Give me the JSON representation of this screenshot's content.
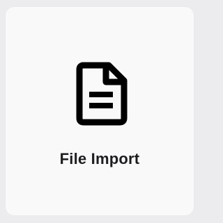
{
  "card": {
    "label": "File Import",
    "icon": "file-document-icon",
    "background_color": "#f9f9fa",
    "page_background_color": "#ececee",
    "text_color": "#1d1d1f",
    "icon_color": "#000000"
  }
}
